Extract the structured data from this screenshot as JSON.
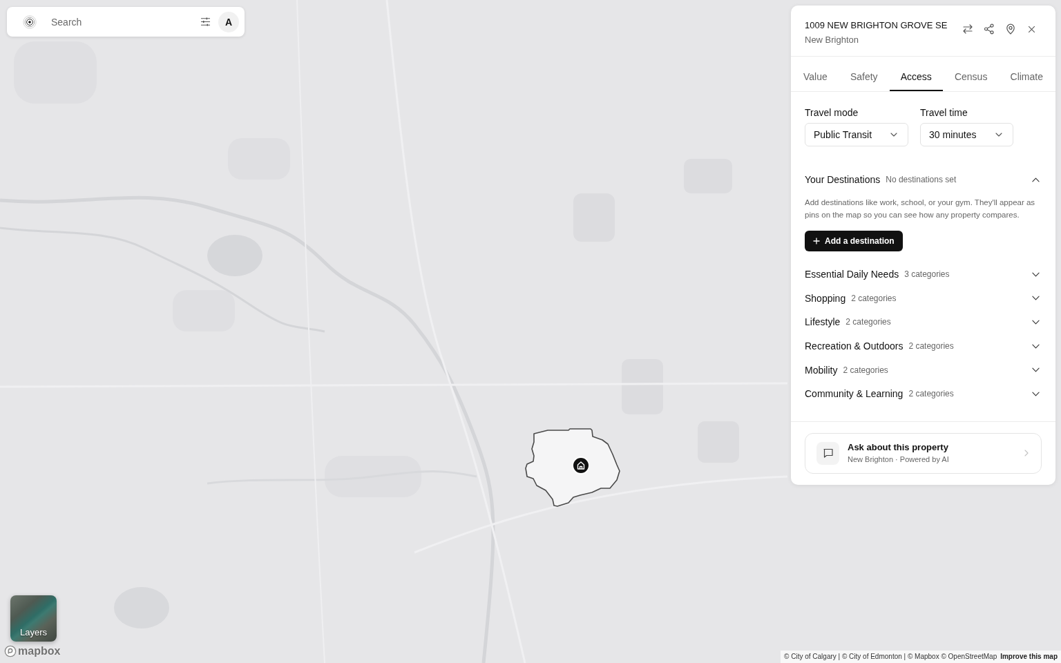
{
  "search": {
    "placeholder": "Search",
    "avatar": "A"
  },
  "map": {
    "layers_label": "Layers",
    "logo": "mapbox",
    "attribution": "© City of Calgary | © City of Edmonton | © Mapbox © OpenStreetMap",
    "improve_link": "Improve this map"
  },
  "panel": {
    "title": "1009 NEW BRIGHTON GROVE SE",
    "subtitle": "New Brighton",
    "tabs": [
      {
        "label": "Value",
        "selected": false
      },
      {
        "label": "Safety",
        "selected": false
      },
      {
        "label": "Access",
        "selected": true
      },
      {
        "label": "Census",
        "selected": false
      },
      {
        "label": "Climate",
        "selected": false
      }
    ],
    "fields": [
      {
        "label": "Travel mode",
        "value": "Public Transit"
      },
      {
        "label": "Travel time",
        "value": "30 minutes"
      }
    ],
    "destinations": {
      "title": "Your Destinations",
      "status": "No destinations set",
      "expanded": true,
      "description": "Add destinations like work, school, or your gym. They'll appear as pins on the map so you can see how any property compares.",
      "button": "Add a destination"
    },
    "categories": [
      {
        "name": "Essential Daily Needs",
        "count": "3 categories",
        "expanded": false
      },
      {
        "name": "Shopping",
        "count": "2 categories",
        "expanded": false
      },
      {
        "name": "Lifestyle",
        "count": "2 categories",
        "expanded": false
      },
      {
        "name": "Recreation & Outdoors",
        "count": "2 categories",
        "expanded": false
      },
      {
        "name": "Mobility",
        "count": "2 categories",
        "expanded": false
      },
      {
        "name": "Community & Learning",
        "count": "2 categories",
        "expanded": false
      }
    ],
    "assistant": {
      "title": "Ask about this property",
      "subtitle": "New Brighton · Powered by AI"
    }
  }
}
